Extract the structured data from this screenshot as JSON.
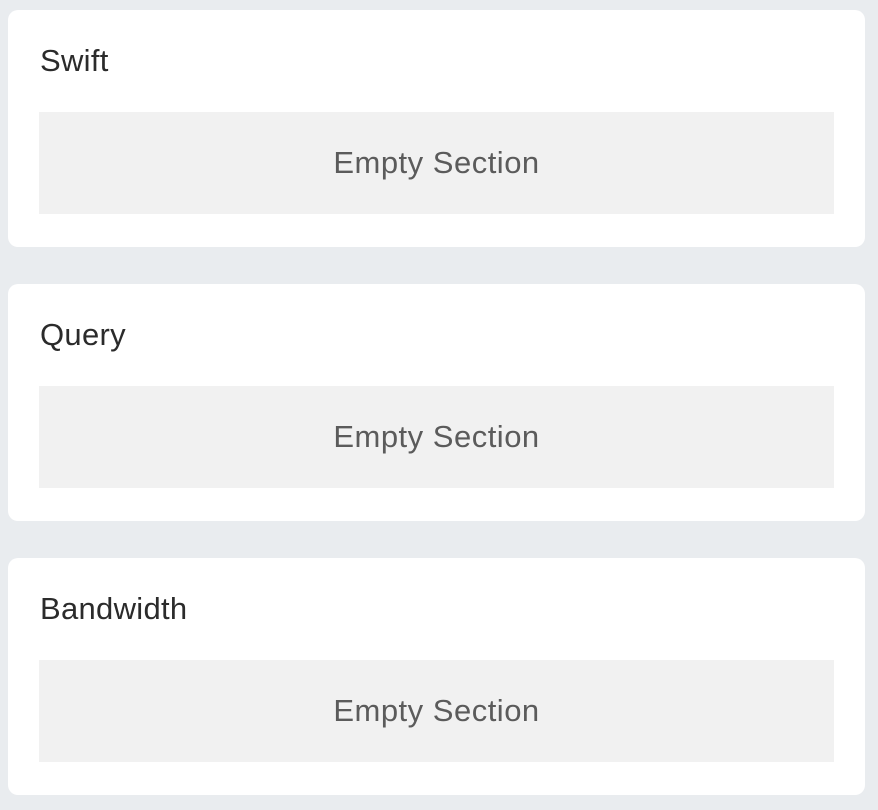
{
  "sections": [
    {
      "title": "Swift",
      "empty_label": "Empty Section"
    },
    {
      "title": "Query",
      "empty_label": "Empty Section"
    },
    {
      "title": "Bandwidth",
      "empty_label": "Empty Section"
    }
  ],
  "colors": {
    "page_background": "#e9ecef",
    "card_background": "#ffffff",
    "empty_background": "#f1f1f1",
    "title_text": "#2b2b2b",
    "empty_text": "#5b5b5b"
  }
}
